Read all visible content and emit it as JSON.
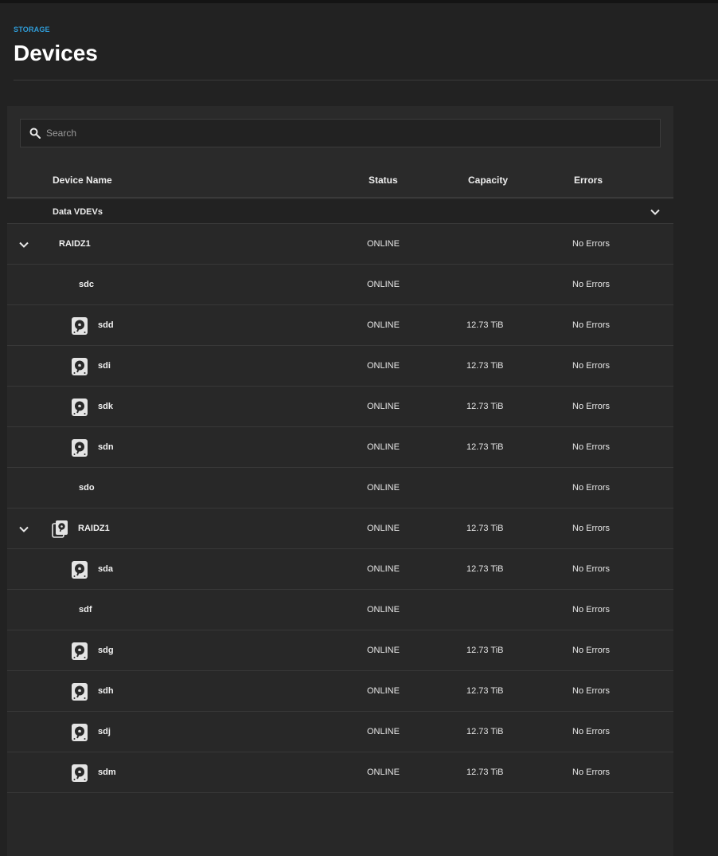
{
  "breadcrumb": "STORAGE",
  "page_title": "Devices",
  "search": {
    "placeholder": "Search"
  },
  "columns": {
    "name": "Device Name",
    "status": "Status",
    "capacity": "Capacity",
    "errors": "Errors"
  },
  "group": {
    "label": "Data VDEVs"
  },
  "rows": [
    {
      "name": "RAIDZ1",
      "status": "ONLINE",
      "capacity": "",
      "errors": "No Errors",
      "kind": "vdev",
      "icon": "none"
    },
    {
      "name": "sdc",
      "status": "ONLINE",
      "capacity": "",
      "errors": "No Errors",
      "kind": "disk",
      "icon": "none"
    },
    {
      "name": "sdd",
      "status": "ONLINE",
      "capacity": "12.73 TiB",
      "errors": "No Errors",
      "kind": "disk",
      "icon": "hdd-icon"
    },
    {
      "name": "sdi",
      "status": "ONLINE",
      "capacity": "12.73 TiB",
      "errors": "No Errors",
      "kind": "disk",
      "icon": "hdd-icon"
    },
    {
      "name": "sdk",
      "status": "ONLINE",
      "capacity": "12.73 TiB",
      "errors": "No Errors",
      "kind": "disk",
      "icon": "hdd-icon"
    },
    {
      "name": "sdn",
      "status": "ONLINE",
      "capacity": "12.73 TiB",
      "errors": "No Errors",
      "kind": "disk",
      "icon": "hdd-icon"
    },
    {
      "name": "sdo",
      "status": "ONLINE",
      "capacity": "",
      "errors": "No Errors",
      "kind": "disk",
      "icon": "none"
    },
    {
      "name": "RAIDZ1",
      "status": "ONLINE",
      "capacity": "12.73 TiB",
      "errors": "No Errors",
      "kind": "vdev",
      "icon": "vdev-stack-icon"
    },
    {
      "name": "sda",
      "status": "ONLINE",
      "capacity": "12.73 TiB",
      "errors": "No Errors",
      "kind": "disk",
      "icon": "hdd-icon"
    },
    {
      "name": "sdf",
      "status": "ONLINE",
      "capacity": "",
      "errors": "No Errors",
      "kind": "disk",
      "icon": "none"
    },
    {
      "name": "sdg",
      "status": "ONLINE",
      "capacity": "12.73 TiB",
      "errors": "No Errors",
      "kind": "disk",
      "icon": "hdd-icon"
    },
    {
      "name": "sdh",
      "status": "ONLINE",
      "capacity": "12.73 TiB",
      "errors": "No Errors",
      "kind": "disk",
      "icon": "hdd-icon"
    },
    {
      "name": "sdj",
      "status": "ONLINE",
      "capacity": "12.73 TiB",
      "errors": "No Errors",
      "kind": "disk",
      "icon": "hdd-icon"
    },
    {
      "name": "sdm",
      "status": "ONLINE",
      "capacity": "12.73 TiB",
      "errors": "No Errors",
      "kind": "disk",
      "icon": "hdd-icon"
    }
  ]
}
